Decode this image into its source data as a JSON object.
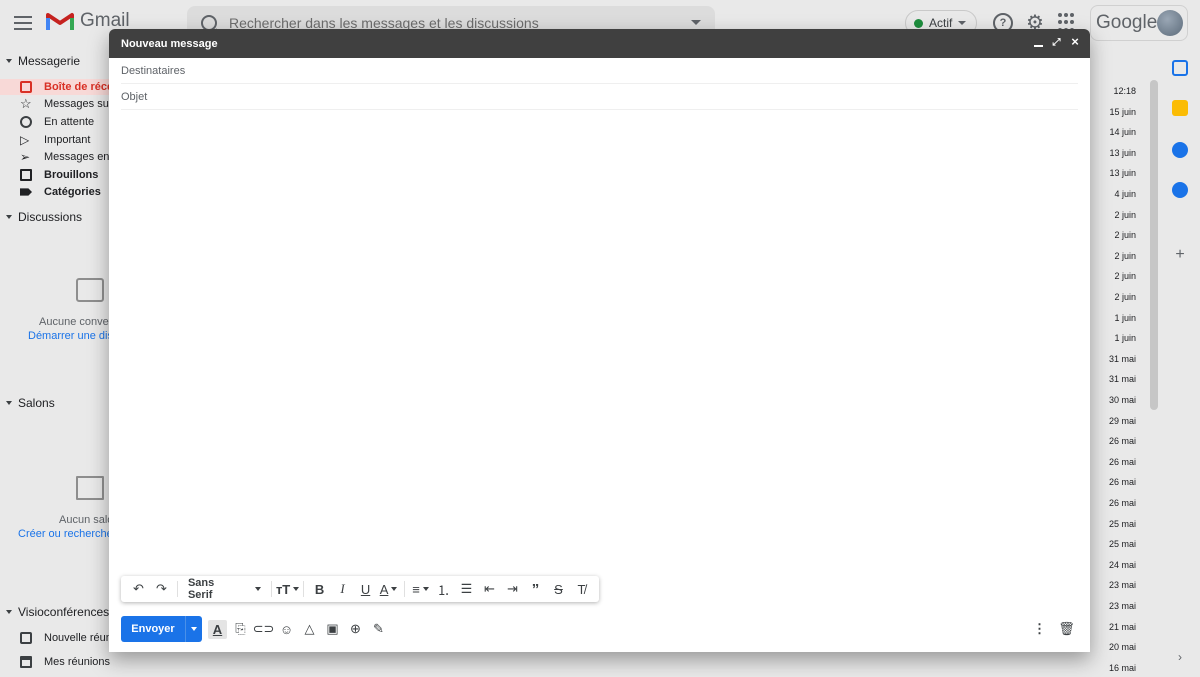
{
  "app": {
    "name": "Gmail"
  },
  "search": {
    "placeholder": "Rechercher dans les messages et les discussions"
  },
  "status": {
    "label": "Actif"
  },
  "brand": {
    "google": "Google"
  },
  "nav": {
    "mail_section": "Messagerie",
    "items": [
      {
        "label": "Boîte de récep",
        "active": true
      },
      {
        "label": "Messages sui"
      },
      {
        "label": "En attente"
      },
      {
        "label": "Important"
      },
      {
        "label": "Messages en"
      },
      {
        "label": "Brouillons"
      },
      {
        "label": "Catégories"
      }
    ],
    "chat_section": "Discussions",
    "chat_empty": "Aucune conver",
    "chat_link": "Démarrer une dis",
    "rooms_section": "Salons",
    "rooms_empty": "Aucun salo",
    "rooms_link": "Créer ou recherche",
    "meet_section": "Visioconférences",
    "meet_items": [
      {
        "label": "Nouvelle réuni"
      },
      {
        "label": "Mes réunions"
      }
    ]
  },
  "list_dates": [
    "12:18",
    "15 juin",
    "14 juin",
    "13 juin",
    "13 juin",
    "4 juin",
    "2 juin",
    "2 juin",
    "2 juin",
    "2 juin",
    "2 juin",
    "1 juin",
    "1 juin",
    "31 mai",
    "31 mai",
    "30 mai",
    "29 mai",
    "26 mai",
    "26 mai",
    "26 mai",
    "26 mai",
    "25 mai",
    "25 mai",
    "24 mai",
    "23 mai",
    "23 mai",
    "21 mai",
    "20 mai",
    "16 mai"
  ],
  "compose": {
    "title": "Nouveau message",
    "to_placeholder": "Destinataires",
    "subject_placeholder": "Objet",
    "font_name": "Sans Serif",
    "send_label": "Envoyer"
  },
  "colors": {
    "accent": "#1a73e8",
    "header": "#404040",
    "active_nav": "#d93025"
  }
}
